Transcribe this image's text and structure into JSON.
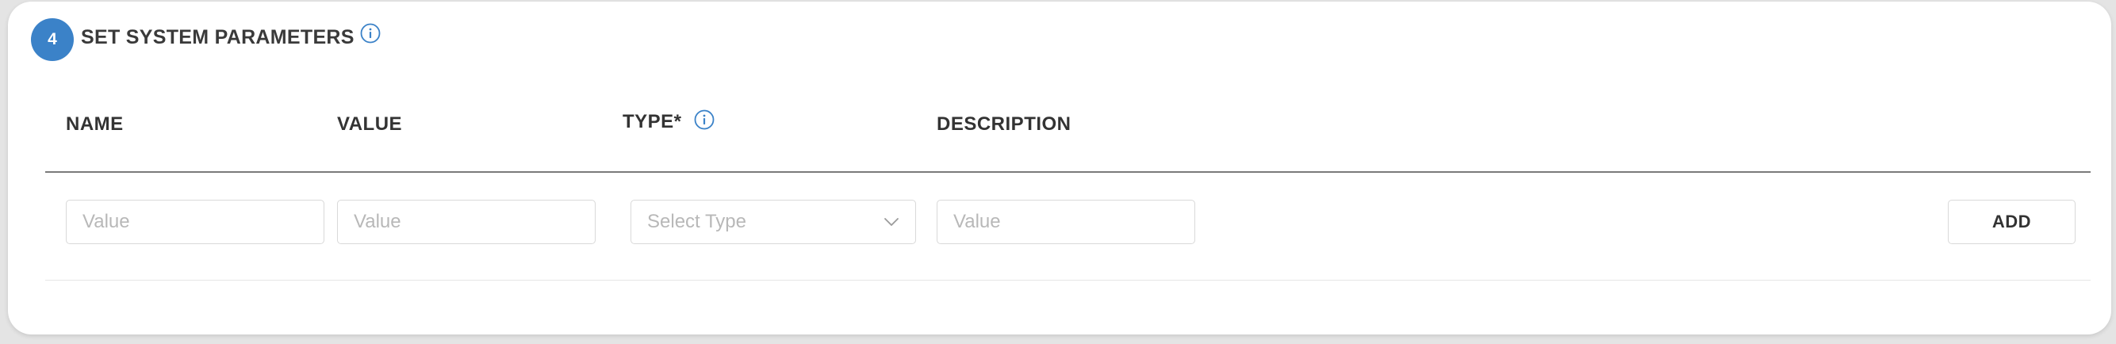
{
  "section": {
    "step_number": "4",
    "title": "SET SYSTEM PARAMETERS"
  },
  "columns": {
    "name": "NAME",
    "value": "VALUE",
    "type": "TYPE*",
    "description": "DESCRIPTION"
  },
  "form": {
    "name_placeholder": "Value",
    "value_placeholder": "Value",
    "type_placeholder": "Select Type",
    "description_placeholder": "Value",
    "add_label": "ADD"
  },
  "colors": {
    "accent": "#3b82c8",
    "text": "#333333",
    "placeholder": "#b8b8b8",
    "border": "#d9d9d9"
  }
}
